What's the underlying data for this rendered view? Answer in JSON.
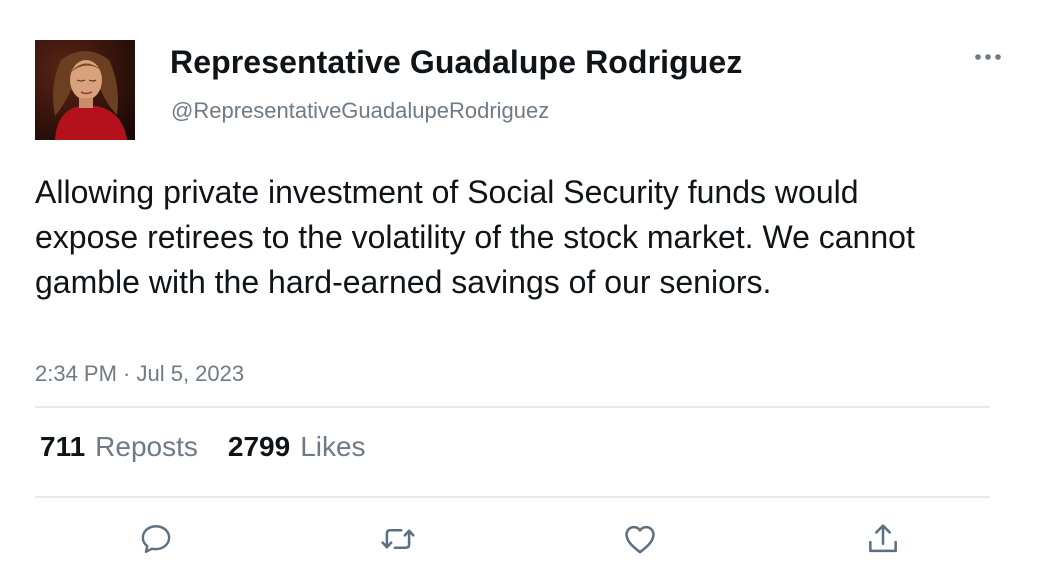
{
  "author": {
    "display_name": "Representative Guadalupe Rodriguez",
    "handle": "@RepresentativeGuadalupeRodriguez"
  },
  "tweet": {
    "text": "Allowing private investment of Social Security funds would expose retirees to the volatility of the stock market. We cannot gamble with the hard-earned savings of our seniors.",
    "timestamp": "2:34 PM · Jul 5, 2023"
  },
  "stats": {
    "reposts_count": "711",
    "reposts_label": "Reposts",
    "likes_count": "2799",
    "likes_label": "Likes"
  },
  "icons": {
    "more": "more-icon",
    "reply": "reply-icon",
    "repost": "repost-icon",
    "like": "like-icon",
    "share": "share-icon"
  },
  "colors": {
    "text_primary": "#0f1419",
    "text_secondary": "#6f7a85",
    "divider": "#e6e9eb",
    "icon": "#5b7083"
  }
}
